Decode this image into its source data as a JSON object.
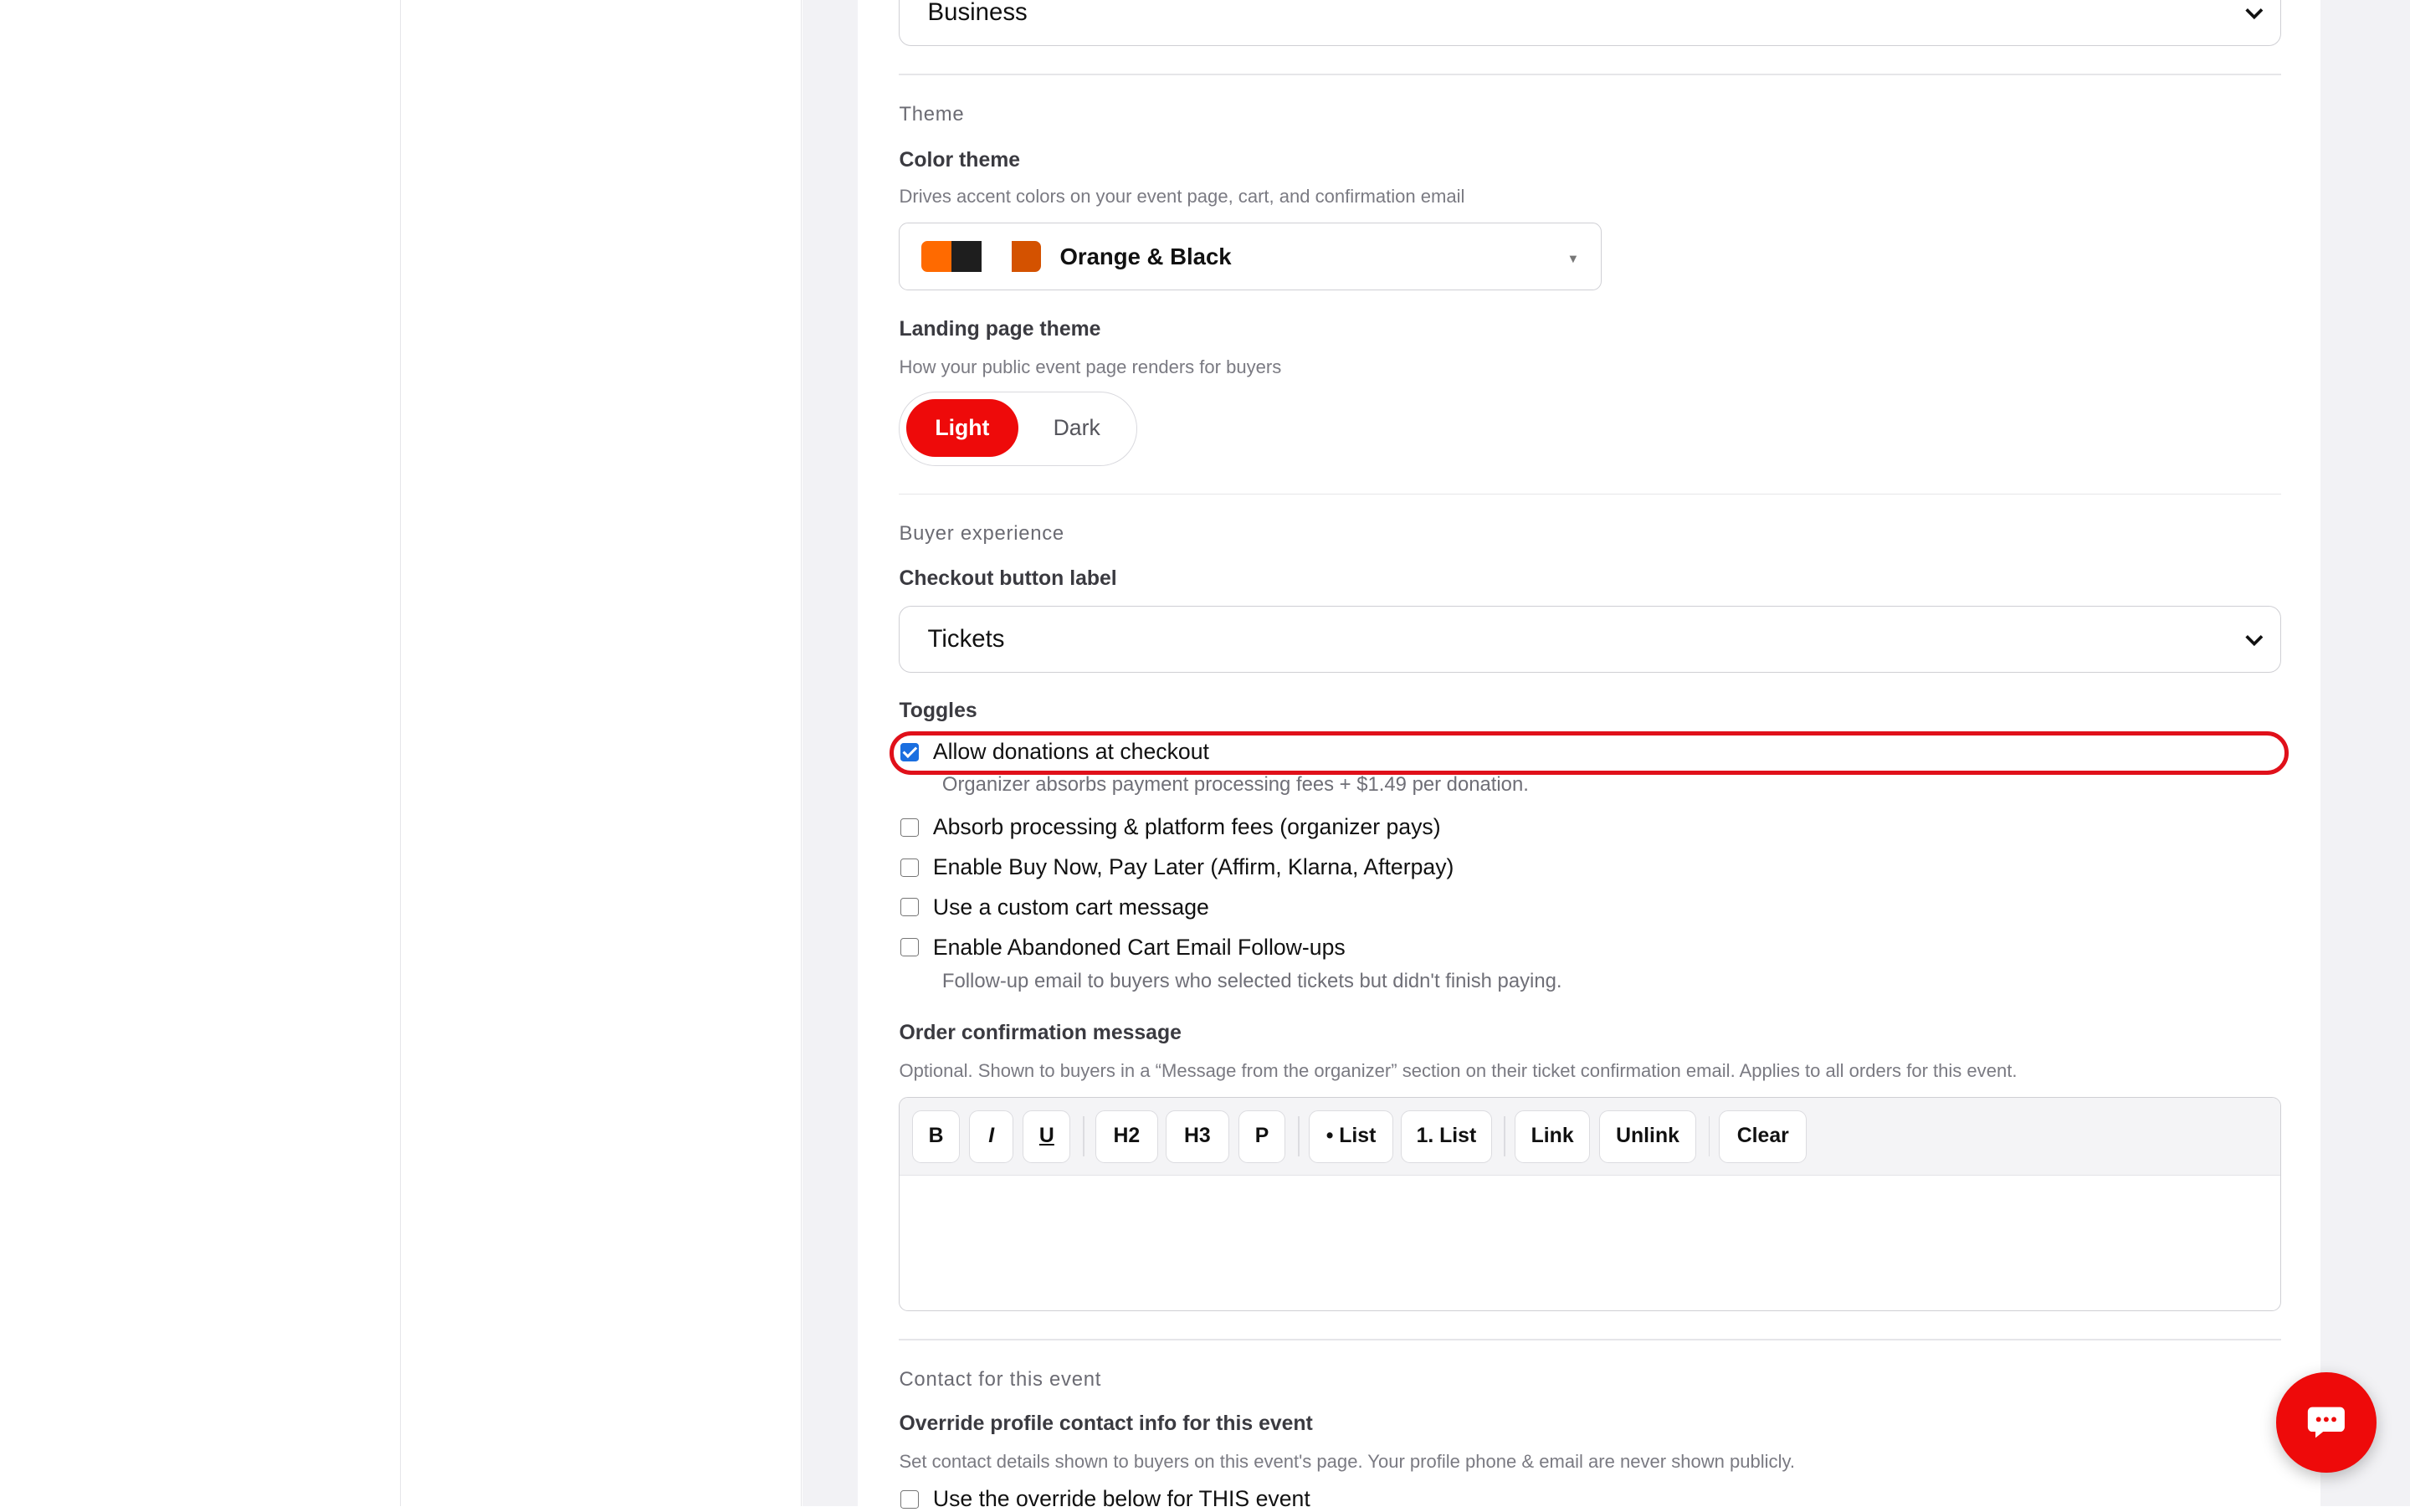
{
  "top_select": {
    "value": "Business"
  },
  "theme": {
    "section": "Theme",
    "color_label": "Color theme",
    "color_help": "Drives accent colors on your event page, cart, and confirmation email",
    "color_value": "Orange & Black",
    "swatch_colors": [
      "#ff6a00",
      "#1e1e1e",
      "#ffffff",
      "#d45200"
    ],
    "landing_label": "Landing page theme",
    "landing_help": "How your public event page renders for buyers",
    "landing_options": [
      "Light",
      "Dark"
    ],
    "landing_selected": "Light",
    "accent": "#ee0a0a"
  },
  "buyer": {
    "section": "Buyer experience",
    "checkout_label": "Checkout button label",
    "checkout_value": "Tickets",
    "toggles_label": "Toggles",
    "toggles": [
      {
        "label": "Allow donations at checkout",
        "checked": true,
        "help": "Organizer absorbs payment processing fees + $1.49 per donation."
      },
      {
        "label": "Absorb processing & platform fees (organizer pays)",
        "checked": false
      },
      {
        "label": "Enable Buy Now, Pay Later (Affirm, Klarna, Afterpay)",
        "checked": false
      },
      {
        "label": "Use a custom cart message",
        "checked": false
      },
      {
        "label": "Enable Abandoned Cart Email Follow-ups",
        "checked": false,
        "help": "Follow-up email to buyers who selected tickets but didn't finish paying."
      }
    ]
  },
  "order": {
    "label": "Order confirmation message",
    "help": "Optional. Shown to buyers in a “Message from the organizer” section on their ticket confirmation email. Applies to all orders for this event.",
    "toolbar": [
      "B",
      "I",
      "U",
      "H2",
      "H3",
      "P",
      "• List",
      "1. List",
      "Link",
      "Unlink",
      "Clear"
    ],
    "content": ""
  },
  "contact": {
    "section": "Contact for this event",
    "override_label": "Override profile contact info for this event",
    "override_help": "Set contact details shown to buyers on this event's page. Your profile phone & email are never shown publicly.",
    "override_checkbox": "Use the override below for THIS event"
  },
  "chat": {
    "icon": "chat-bubble-icon"
  }
}
